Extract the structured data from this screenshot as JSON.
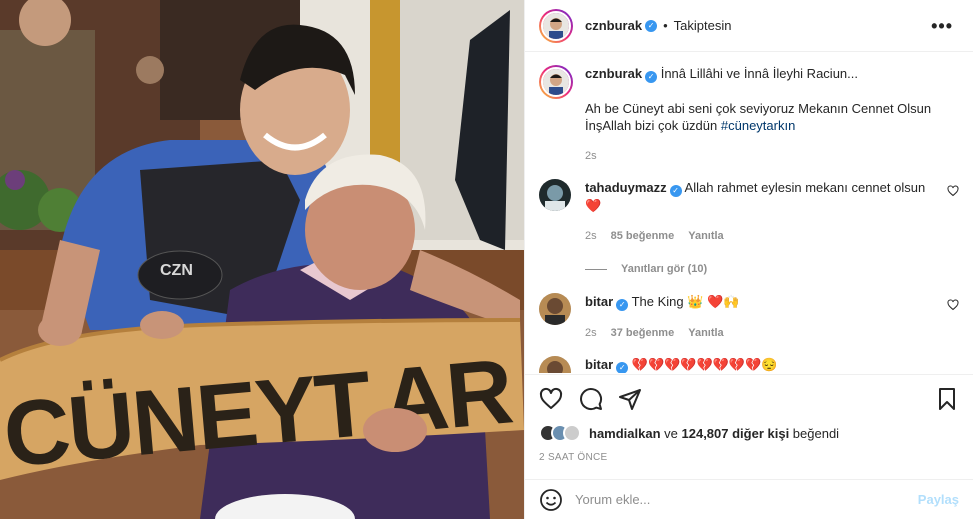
{
  "post": {
    "username": "cznburak",
    "follow_status": "Takiptesin",
    "more_label": "•••",
    "caption_line1": "İnnâ Lillâhi ve İnnâ İleyhi Raciun...",
    "caption_line2": "Ah be Cüneyt abi seni çok seviyoruz Mekanın Cennet Olsun İnşAllah bizi çok üzdün",
    "caption_hashtag": "#cüneytarkın",
    "caption_time": "2s",
    "bread_text": "CÜNEYT.AR",
    "apron_text": "CZN"
  },
  "comments": [
    {
      "username": "tahaduymazz",
      "text": "Allah rahmet eylesin mekanı cennet olsun",
      "emoji": "❤️",
      "time": "2s",
      "likes": "85 beğenme",
      "reply": "Yanıtla"
    },
    {
      "username": "bitar",
      "text": "The King 👑 ❤️🙌",
      "time": "2s",
      "likes": "37 beğenme",
      "reply": "Yanıtla"
    },
    {
      "username": "bitar",
      "text": "💔💔💔💔💔💔💔💔😔"
    }
  ],
  "replies_label": "Yanıtları gör (10)",
  "likes": {
    "first_user": "hamdialkan",
    "rest": " ve ",
    "count": "124,807 diğer kişi",
    "suffix": " beğendi"
  },
  "timestamp": "2 SAAT ÖNCE",
  "add_comment": {
    "placeholder": "Yorum ekle...",
    "post_label": "Paylaş"
  },
  "colors": {
    "verified": "#3897f0",
    "like_red": "#ed4956",
    "hashtag": "#00376b",
    "post_disabled": "#b2dffc"
  },
  "icons": [
    "heart-icon",
    "comment-icon",
    "share-icon",
    "bookmark-icon",
    "emoji-icon",
    "more-icon",
    "verified-icon"
  ]
}
